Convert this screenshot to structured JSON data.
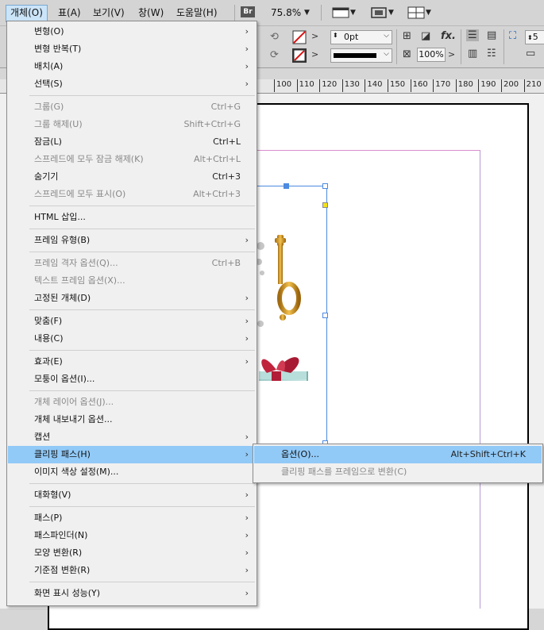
{
  "menubar": {
    "items": [
      {
        "label": "개체(O)",
        "active": true
      },
      {
        "label": "표(A)"
      },
      {
        "label": "보기(V)"
      },
      {
        "label": "창(W)"
      },
      {
        "label": "도움말(H)"
      }
    ],
    "bridge_label": "Br",
    "zoom": "75.8%"
  },
  "control": {
    "stroke_weight": "0pt",
    "scale": "100%",
    "right_value": "5"
  },
  "ruler": {
    "ticks": [
      "100",
      "110",
      "120",
      "130",
      "140",
      "150",
      "160",
      "170",
      "180",
      "190",
      "200",
      "210"
    ]
  },
  "object_menu": {
    "items": [
      {
        "label": "변형(O)",
        "submenu": true
      },
      {
        "label": "변형 반복(T)",
        "submenu": true
      },
      {
        "label": "배치(A)",
        "submenu": true
      },
      {
        "label": "선택(S)",
        "submenu": true
      },
      {
        "sep": true
      },
      {
        "label": "그룹(G)",
        "shortcut": "Ctrl+G",
        "disabled": true
      },
      {
        "label": "그룹 해제(U)",
        "shortcut": "Shift+Ctrl+G",
        "disabled": true
      },
      {
        "label": "잠금(L)",
        "shortcut": "Ctrl+L"
      },
      {
        "label": "스프레드에 모두 잠금 해제(K)",
        "shortcut": "Alt+Ctrl+L",
        "disabled": true
      },
      {
        "label": "숨기기",
        "shortcut": "Ctrl+3"
      },
      {
        "label": "스프레드에 모두 표시(O)",
        "shortcut": "Alt+Ctrl+3",
        "disabled": true
      },
      {
        "sep": true
      },
      {
        "label": "HTML 삽입..."
      },
      {
        "sep": true
      },
      {
        "label": "프레임 유형(B)",
        "submenu": true
      },
      {
        "sep": true
      },
      {
        "label": "프레임 격자 옵션(Q)...",
        "shortcut": "Ctrl+B",
        "disabled": true
      },
      {
        "label": "텍스트 프레임 옵션(X)...",
        "disabled": true
      },
      {
        "label": "고정된 개체(D)",
        "submenu": true
      },
      {
        "sep": true
      },
      {
        "label": "맞춤(F)",
        "submenu": true
      },
      {
        "label": "내용(C)",
        "submenu": true
      },
      {
        "sep": true
      },
      {
        "label": "효과(E)",
        "submenu": true
      },
      {
        "label": "모퉁이 옵션(I)..."
      },
      {
        "sep": true
      },
      {
        "label": "개체 레이어 옵션(J)...",
        "disabled": true
      },
      {
        "label": "개체 내보내기 옵션..."
      },
      {
        "label": "캡션",
        "submenu": true
      },
      {
        "label": "클리핑 패스(H)",
        "submenu": true,
        "highlighted": true
      },
      {
        "label": "이미지 색상 설정(M)..."
      },
      {
        "sep": true
      },
      {
        "label": "대화형(V)",
        "submenu": true
      },
      {
        "sep": true
      },
      {
        "label": "패스(P)",
        "submenu": true
      },
      {
        "label": "패스파인더(N)",
        "submenu": true
      },
      {
        "label": "모양 변환(R)",
        "submenu": true
      },
      {
        "label": "기준점 변환(R)",
        "submenu": true
      },
      {
        "sep": true
      },
      {
        "label": "화면 표시 성능(Y)",
        "submenu": true
      }
    ]
  },
  "clipping_submenu": {
    "items": [
      {
        "label": "옵션(O)...",
        "shortcut": "Alt+Shift+Ctrl+K",
        "highlighted": true
      },
      {
        "label": "클리핑 패스를 프레임으로 변환(C)",
        "disabled": true
      }
    ]
  },
  "icons": {
    "submenu_arrow": "chevron-right-icon",
    "dropdown": "caret-down-icon"
  },
  "colors": {
    "highlight": "#91c9f7",
    "menu_bg": "#f0f0f0",
    "selection": "#4d8ae0"
  }
}
